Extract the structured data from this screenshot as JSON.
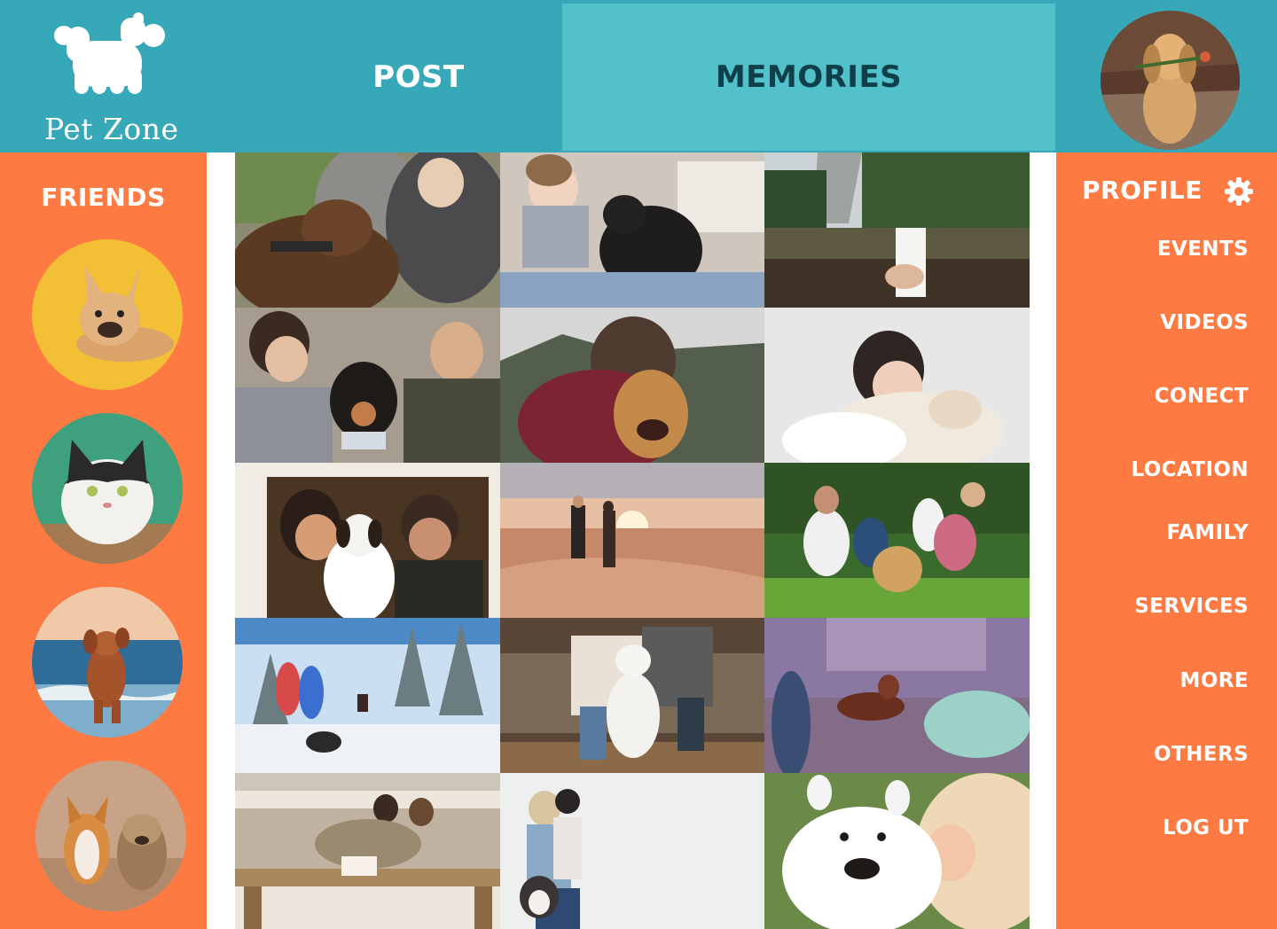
{
  "app": {
    "name": "Pet Zone",
    "logo_icon": "dog-silhouette-icon"
  },
  "colors": {
    "header": "#37A8B8",
    "active_tab": "#52C1CA",
    "active_tab_text": "#0E3F4A",
    "sidebar": "#FE7A43",
    "text_light": "#FFFFFF"
  },
  "nav": {
    "tabs": [
      {
        "label": "POST",
        "active": false
      },
      {
        "label": "MEMORIES",
        "active": true
      }
    ]
  },
  "header": {
    "avatar_icon": "user-avatar-dog-with-rose"
  },
  "friends": {
    "title": "FRIENDS",
    "items": [
      {
        "icon": "french-bulldog-avatar"
      },
      {
        "icon": "cat-avatar"
      },
      {
        "icon": "dog-running-beach-avatar"
      },
      {
        "icon": "corgi-and-terrier-avatar"
      }
    ]
  },
  "memories": {
    "photos": [
      {
        "icon": "couple-with-brown-dog-photo"
      },
      {
        "icon": "girl-with-black-cat-photo"
      },
      {
        "icon": "water-carton-lake-photo"
      },
      {
        "icon": "couple-petting-dachshund-photo"
      },
      {
        "icon": "man-hugging-golden-retriever-photo"
      },
      {
        "icon": "woman-sleeping-on-white-dog-photo"
      },
      {
        "icon": "couple-with-dog-in-window-photo"
      },
      {
        "icon": "couple-in-desert-at-sunset-photo"
      },
      {
        "icon": "family-with-golden-retriever-photo"
      },
      {
        "icon": "couple-in-snow-with-dog-photo"
      },
      {
        "icon": "people-with-white-poodle-photo"
      },
      {
        "icon": "chihuahua-on-couch-photo"
      },
      {
        "icon": "cat-on-coffee-table-photo"
      },
      {
        "icon": "woman-with-child-and-husky-photo"
      },
      {
        "icon": "woman-with-samoyed-photo"
      }
    ]
  },
  "profile": {
    "title": "PROFILE",
    "settings_icon": "gear-icon",
    "menu": [
      {
        "label": "EVENTS"
      },
      {
        "label": "VIDEOS"
      },
      {
        "label": "CONECT"
      },
      {
        "label": "LOCATION"
      },
      {
        "label": "FAMILY"
      },
      {
        "label": "SERVICES"
      },
      {
        "label": "MORE"
      },
      {
        "label": "OTHERS"
      },
      {
        "label": "LOG UT"
      }
    ]
  }
}
